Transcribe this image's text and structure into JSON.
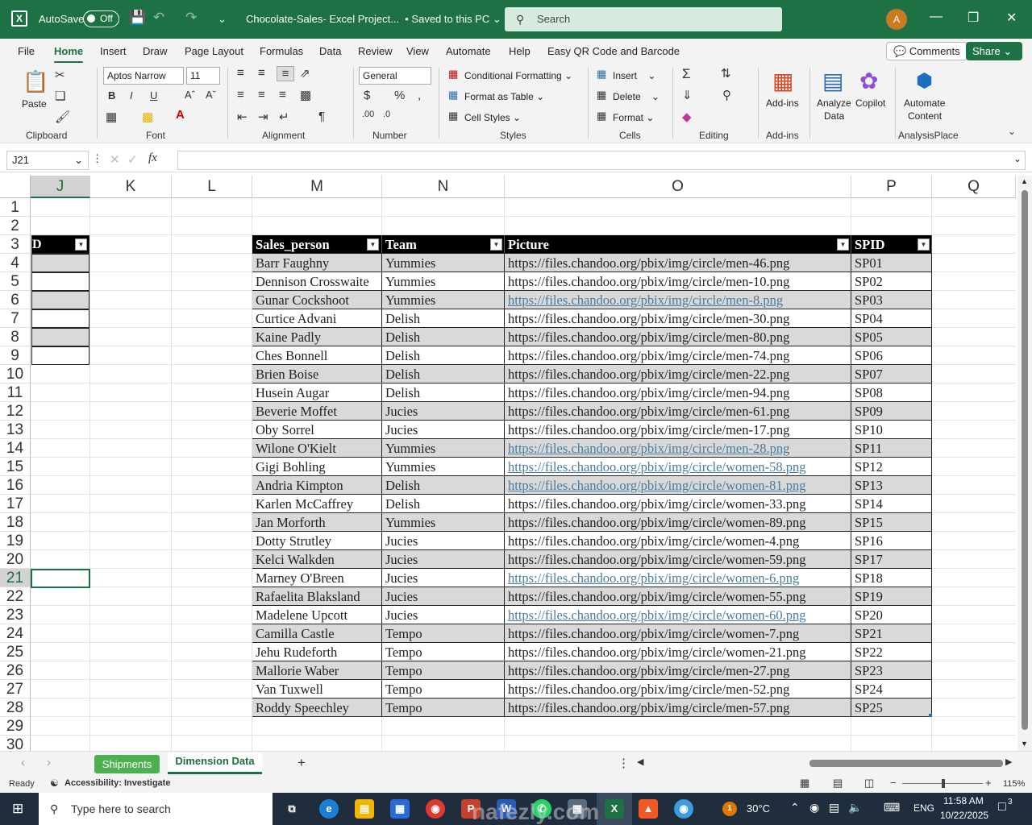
{
  "titlebar": {
    "autosave_label": "AutoSave",
    "autosave_state": "Off",
    "doc_title": "Chocolate-Sales- Excel Project...",
    "save_status": "• Saved to this PC",
    "search_placeholder": "Search",
    "avatar_initial": "A"
  },
  "menu": {
    "items": [
      "File",
      "Home",
      "Insert",
      "Draw",
      "Page Layout",
      "Formulas",
      "Data",
      "Review",
      "View",
      "Automate",
      "Help",
      "Easy QR Code and Barcode"
    ],
    "active": "Home",
    "comments": "Comments",
    "share": "Share"
  },
  "ribbon": {
    "paste": "Paste",
    "clipboard": "Clipboard",
    "font_name": "Aptos Narrow",
    "font_size": "11",
    "font": "Font",
    "alignment": "Alignment",
    "number_format": "General",
    "number": "Number",
    "conditional_formatting": "Conditional Formatting",
    "format_as_table": "Format as Table",
    "cell_styles": "Cell Styles",
    "styles": "Styles",
    "insert": "Insert",
    "delete": "Delete",
    "format": "Format",
    "cells": "Cells",
    "editing": "Editing",
    "addins_btn": "Add-ins",
    "addins_group": "Add-ins",
    "analyze_data_1": "Analyze",
    "analyze_data_2": "Data",
    "copilot": "Copilot",
    "automate_1": "Automate",
    "automate_2": "Content",
    "analysisplace": "AnalysisPlace"
  },
  "formula_bar": {
    "name_box": "J21",
    "fx": "fx",
    "value": ""
  },
  "grid": {
    "columns": [
      "J",
      "K",
      "L",
      "M",
      "N",
      "O",
      "P",
      "Q"
    ],
    "selected_column": "J",
    "rows": [
      "1",
      "2",
      "3",
      "4",
      "5",
      "6",
      "7",
      "8",
      "9",
      "10",
      "11",
      "12",
      "13",
      "14",
      "15",
      "16",
      "17",
      "18",
      "19",
      "20",
      "21",
      "22",
      "23",
      "24",
      "25",
      "26",
      "27",
      "28",
      "29",
      "30"
    ],
    "selected_row": "21",
    "j_header_fragment": "D"
  },
  "table": {
    "headers": [
      "Sales_person",
      "Team",
      "Picture",
      "SPID"
    ],
    "rows": [
      {
        "name": "Barr Faughny",
        "team": "Yummies",
        "picture": "https://files.chandoo.org/pbix/img/circle/men-46.png",
        "spid": "SP01",
        "link": false
      },
      {
        "name": "Dennison Crosswaite",
        "team": "Yummies",
        "picture": "https://files.chandoo.org/pbix/img/circle/men-10.png",
        "spid": "SP02",
        "link": false
      },
      {
        "name": "Gunar Cockshoot",
        "team": "Yummies",
        "picture": "https://files.chandoo.org/pbix/img/circle/men-8.png",
        "spid": "SP03",
        "link": true
      },
      {
        "name": "Curtice Advani",
        "team": "Delish",
        "picture": "https://files.chandoo.org/pbix/img/circle/men-30.png",
        "spid": "SP04",
        "link": false
      },
      {
        "name": "Kaine Padly",
        "team": "Delish",
        "picture": "https://files.chandoo.org/pbix/img/circle/men-80.png",
        "spid": "SP05",
        "link": false
      },
      {
        "name": "Ches Bonnell",
        "team": "Delish",
        "picture": "https://files.chandoo.org/pbix/img/circle/men-74.png",
        "spid": "SP06",
        "link": false
      },
      {
        "name": "Brien Boise",
        "team": "Delish",
        "picture": "https://files.chandoo.org/pbix/img/circle/men-22.png",
        "spid": "SP07",
        "link": false
      },
      {
        "name": "Husein Augar",
        "team": "Delish",
        "picture": "https://files.chandoo.org/pbix/img/circle/men-94.png",
        "spid": "SP08",
        "link": false
      },
      {
        "name": "Beverie Moffet",
        "team": "Jucies",
        "picture": "https://files.chandoo.org/pbix/img/circle/men-61.png",
        "spid": "SP09",
        "link": false
      },
      {
        "name": "Oby Sorrel",
        "team": "Jucies",
        "picture": "https://files.chandoo.org/pbix/img/circle/men-17.png",
        "spid": "SP10",
        "link": false
      },
      {
        "name": "Wilone O'Kielt",
        "team": "Yummies",
        "picture": "https://files.chandoo.org/pbix/img/circle/men-28.png",
        "spid": "SP11",
        "link": true
      },
      {
        "name": "Gigi Bohling",
        "team": "Yummies",
        "picture": "https://files.chandoo.org/pbix/img/circle/women-58.png",
        "spid": "SP12",
        "link": true
      },
      {
        "name": "Andria Kimpton",
        "team": "Delish",
        "picture": "https://files.chandoo.org/pbix/img/circle/women-81.png",
        "spid": "SP13",
        "link": true
      },
      {
        "name": "Karlen McCaffrey",
        "team": "Delish",
        "picture": "https://files.chandoo.org/pbix/img/circle/women-33.png",
        "spid": "SP14",
        "link": false
      },
      {
        "name": "Jan Morforth",
        "team": "Yummies",
        "picture": "https://files.chandoo.org/pbix/img/circle/women-89.png",
        "spid": "SP15",
        "link": false
      },
      {
        "name": "Dotty Strutley",
        "team": "Jucies",
        "picture": "https://files.chandoo.org/pbix/img/circle/women-4.png",
        "spid": "SP16",
        "link": false
      },
      {
        "name": "Kelci Walkden",
        "team": "Jucies",
        "picture": "https://files.chandoo.org/pbix/img/circle/women-59.png",
        "spid": "SP17",
        "link": false
      },
      {
        "name": "Marney O'Breen",
        "team": "Jucies",
        "picture": "https://files.chandoo.org/pbix/img/circle/women-6.png",
        "spid": "SP18",
        "link": true
      },
      {
        "name": "Rafaelita Blaksland",
        "team": "Jucies",
        "picture": "https://files.chandoo.org/pbix/img/circle/women-55.png",
        "spid": "SP19",
        "link": false
      },
      {
        "name": "Madelene Upcott",
        "team": "Jucies",
        "picture": "https://files.chandoo.org/pbix/img/circle/women-60.png",
        "spid": "SP20",
        "link": true
      },
      {
        "name": "Camilla Castle",
        "team": "Tempo",
        "picture": "https://files.chandoo.org/pbix/img/circle/women-7.png",
        "spid": "SP21",
        "link": false
      },
      {
        "name": "Jehu Rudeforth",
        "team": "Tempo",
        "picture": "https://files.chandoo.org/pbix/img/circle/women-21.png",
        "spid": "SP22",
        "link": false
      },
      {
        "name": "Mallorie Waber",
        "team": "Tempo",
        "picture": "https://files.chandoo.org/pbix/img/circle/men-27.png",
        "spid": "SP23",
        "link": false
      },
      {
        "name": "Van Tuxwell",
        "team": "Tempo",
        "picture": "https://files.chandoo.org/pbix/img/circle/men-52.png",
        "spid": "SP24",
        "link": false
      },
      {
        "name": "Roddy Speechley",
        "team": "Tempo",
        "picture": "https://files.chandoo.org/pbix/img/circle/men-57.png",
        "spid": "SP25",
        "link": false
      }
    ]
  },
  "sheets": {
    "tabs": [
      "Shipments",
      "Dimension Data"
    ],
    "active": "Dimension Data"
  },
  "status": {
    "ready": "Ready",
    "accessibility": "Accessibility: Investigate",
    "zoom": "115%"
  },
  "taskbar": {
    "search_placeholder": "Type here to search",
    "temperature": "30°C",
    "language": "ENG",
    "time": "11:58 AM",
    "date": "10/22/2025",
    "notifications": "3"
  },
  "watermark": "nafezly.com"
}
